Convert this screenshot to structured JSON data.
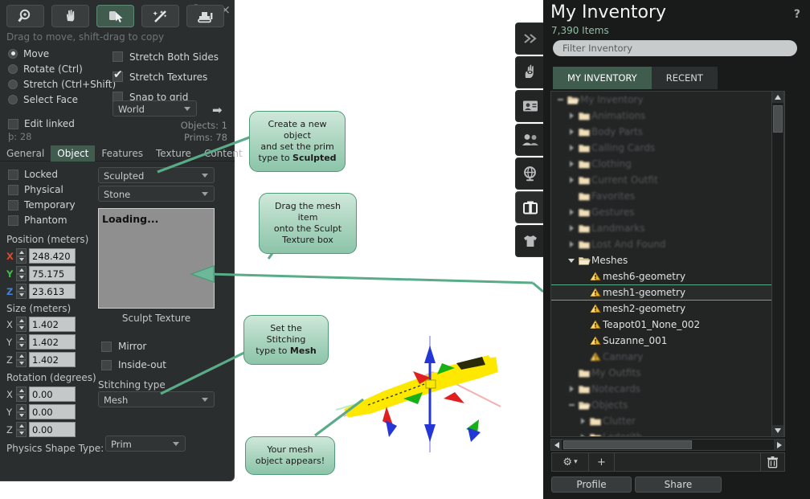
{
  "build_panel": {
    "window_controls": {
      "help": "?",
      "minimize": "–",
      "close": "×"
    },
    "toolbar": [
      {
        "name": "zoom-tool",
        "icon": "magnifier-icon",
        "active": false
      },
      {
        "name": "pan-tool",
        "icon": "hand-icon",
        "active": false
      },
      {
        "name": "grab-tool",
        "icon": "cursor-icon",
        "active": true
      },
      {
        "name": "create-tool",
        "icon": "magic-wand-icon",
        "active": false
      },
      {
        "name": "land-tool",
        "icon": "bulldozer-icon",
        "active": false
      }
    ],
    "hint": "Drag to move, shift-drag to copy",
    "edit_modes": [
      {
        "label": "Move",
        "selected": true
      },
      {
        "label": "Rotate (Ctrl)",
        "selected": false
      },
      {
        "label": "Stretch (Ctrl+Shift)",
        "selected": false
      },
      {
        "label": "Select Face",
        "selected": false
      }
    ],
    "options": [
      {
        "label": "Stretch Both Sides",
        "checked": false
      },
      {
        "label": "Stretch Textures",
        "checked": true
      },
      {
        "label": "Snap to grid",
        "checked": false
      }
    ],
    "grid_mode": "World",
    "grid_options_arrow": "➡",
    "edit_linked": {
      "label": "Edit linked",
      "checked": false
    },
    "part_count": "þ: 28",
    "objects_count": "Objects: 1",
    "prims_count": "Prims: 78",
    "tabs": [
      {
        "label": "General",
        "active": false
      },
      {
        "label": "Object",
        "active": true
      },
      {
        "label": "Features",
        "active": false
      },
      {
        "label": "Texture",
        "active": false
      },
      {
        "label": "Content",
        "active": false
      }
    ],
    "object_tab": {
      "flags": [
        {
          "label": "Locked",
          "checked": false
        },
        {
          "label": "Physical",
          "checked": false
        },
        {
          "label": "Temporary",
          "checked": false
        },
        {
          "label": "Phantom",
          "checked": false
        }
      ],
      "prim_type": "Sculpted",
      "material": "Stone",
      "sculpt_texture_status": "Loading...",
      "sculpt_texture_label": "Sculpt Texture",
      "mirror": {
        "label": "Mirror",
        "checked": false
      },
      "inside_out": {
        "label": "Inside-out",
        "checked": false
      },
      "stitching_label": "Stitching type",
      "stitching_type": "Mesh",
      "physics_shape_label": "Physics Shape Type:",
      "physics_shape_type": "Prim",
      "position_label": "Position (meters)",
      "position": {
        "x": "248.420",
        "y": "75.175",
        "z": "23.613"
      },
      "size_label": "Size (meters)",
      "size": {
        "x": "1.402",
        "y": "1.402",
        "z": "1.402"
      },
      "rotation_label": "Rotation (degrees)",
      "rotation": {
        "x": "0.00",
        "y": "0.00",
        "z": "0.00"
      },
      "axis_labels": {
        "x": "X",
        "y": "Y",
        "z": "Z"
      }
    }
  },
  "callouts": [
    {
      "id": "callout-prim-type",
      "lines": [
        "Create a new object",
        "and set the prim",
        "type to "
      ],
      "bold": "Sculpted"
    },
    {
      "id": "callout-drag-mesh",
      "lines": [
        "Drag the mesh item",
        "onto the Sculpt",
        "Texture box"
      ],
      "bold": ""
    },
    {
      "id": "callout-stitching",
      "lines": [
        "Set the Stitching",
        "type to "
      ],
      "bold": "Mesh"
    },
    {
      "id": "callout-appears",
      "lines": [
        "Your mesh",
        "object appears!"
      ],
      "bold": ""
    }
  ],
  "sidebar_strip": [
    {
      "name": "sidebar-expand",
      "icon": "chevron-double-right-icon",
      "active": false
    },
    {
      "name": "sidebar-me",
      "icon": "hand-eye-icon",
      "active": false
    },
    {
      "name": "sidebar-profile",
      "icon": "profile-card-icon",
      "active": false
    },
    {
      "name": "sidebar-people",
      "icon": "people-icon",
      "active": false
    },
    {
      "name": "sidebar-places",
      "icon": "globe-icon",
      "active": false
    },
    {
      "name": "sidebar-inventory",
      "icon": "suitcase-icon",
      "active": true
    },
    {
      "name": "sidebar-appearance",
      "icon": "shirt-icon",
      "active": false
    }
  ],
  "inventory": {
    "title": "My Inventory",
    "help": "?",
    "item_count": "7,390 Items",
    "filter_placeholder": "Filter Inventory",
    "tabs": [
      {
        "label": "MY INVENTORY",
        "active": true
      },
      {
        "label": "RECENT",
        "active": false
      }
    ],
    "tree": [
      {
        "label": "My Inventory",
        "depth": 0,
        "twisty": "minus",
        "icon": "folder-open-icon",
        "kind": "folder",
        "dim": true,
        "selected": false
      },
      {
        "label": "Animations",
        "depth": 1,
        "twisty": "right",
        "icon": "folder-icon",
        "kind": "folder",
        "dim": true,
        "selected": false
      },
      {
        "label": "Body Parts",
        "depth": 1,
        "twisty": "right",
        "icon": "folder-icon",
        "kind": "folder",
        "dim": true,
        "selected": false
      },
      {
        "label": "Calling Cards",
        "depth": 1,
        "twisty": "right",
        "icon": "folder-icon",
        "kind": "folder",
        "dim": true,
        "selected": false
      },
      {
        "label": "Clothing",
        "depth": 1,
        "twisty": "right",
        "icon": "folder-icon",
        "kind": "folder",
        "dim": true,
        "selected": false
      },
      {
        "label": "Current Outfit",
        "depth": 1,
        "twisty": "right",
        "icon": "folder-icon",
        "kind": "folder",
        "dim": true,
        "selected": false
      },
      {
        "label": "Favorites",
        "depth": 1,
        "twisty": "none",
        "icon": "folder-icon",
        "kind": "folder",
        "dim": true,
        "selected": false
      },
      {
        "label": "Gestures",
        "depth": 1,
        "twisty": "right",
        "icon": "folder-icon",
        "kind": "folder",
        "dim": true,
        "selected": false
      },
      {
        "label": "Landmarks",
        "depth": 1,
        "twisty": "right",
        "icon": "folder-icon",
        "kind": "folder",
        "dim": true,
        "selected": false
      },
      {
        "label": "Lost And Found",
        "depth": 1,
        "twisty": "right",
        "icon": "folder-icon",
        "kind": "folder",
        "dim": true,
        "selected": false
      },
      {
        "label": "Meshes",
        "depth": 1,
        "twisty": "down",
        "icon": "folder-open-icon",
        "kind": "folder",
        "dim": false,
        "selected": false
      },
      {
        "label": "mesh6-geometry",
        "depth": 2,
        "twisty": "none",
        "icon": "mesh-icon",
        "kind": "item",
        "dim": false,
        "selected": false
      },
      {
        "label": "mesh1-geometry",
        "depth": 2,
        "twisty": "none",
        "icon": "mesh-icon",
        "kind": "item",
        "dim": false,
        "selected": true
      },
      {
        "label": "mesh2-geometry",
        "depth": 2,
        "twisty": "none",
        "icon": "mesh-icon",
        "kind": "item",
        "dim": false,
        "selected": false
      },
      {
        "label": "Teapot01_None_002",
        "depth": 2,
        "twisty": "none",
        "icon": "mesh-icon",
        "kind": "item",
        "dim": false,
        "selected": false
      },
      {
        "label": "Suzanne_001",
        "depth": 2,
        "twisty": "none",
        "icon": "mesh-icon",
        "kind": "item",
        "dim": false,
        "selected": false
      },
      {
        "label": "Cannary",
        "depth": 2,
        "twisty": "none",
        "icon": "mesh-icon",
        "kind": "item",
        "dim": true,
        "selected": false
      },
      {
        "label": "My Outfits",
        "depth": 1,
        "twisty": "none",
        "icon": "folder-icon",
        "kind": "folder",
        "dim": true,
        "selected": false
      },
      {
        "label": "Notecards",
        "depth": 1,
        "twisty": "right",
        "icon": "folder-icon",
        "kind": "folder",
        "dim": true,
        "selected": false
      },
      {
        "label": "Objects",
        "depth": 1,
        "twisty": "minus",
        "icon": "folder-open-icon",
        "kind": "folder",
        "dim": true,
        "selected": false
      },
      {
        "label": "Clutter",
        "depth": 2,
        "twisty": "right",
        "icon": "folder-icon",
        "kind": "folder",
        "dim": true,
        "selected": false
      },
      {
        "label": "Ledorith",
        "depth": 2,
        "twisty": "right",
        "icon": "folder-icon",
        "kind": "folder",
        "dim": true,
        "selected": false
      }
    ],
    "bottom_bar": {
      "gear": "⚙",
      "gear_caret": "▾",
      "add": "+",
      "trash": "trash-icon"
    },
    "profile_button": "Profile",
    "share_button": "Share"
  },
  "colors": {
    "accent_green": "#3f5c4f",
    "callout_border": "#4f9a78",
    "callout_fill": "#a8d3bd",
    "panel_bg": "#2b2e2e",
    "inventory_bg": "#191a1a",
    "count_text": "#8fbfa5"
  }
}
